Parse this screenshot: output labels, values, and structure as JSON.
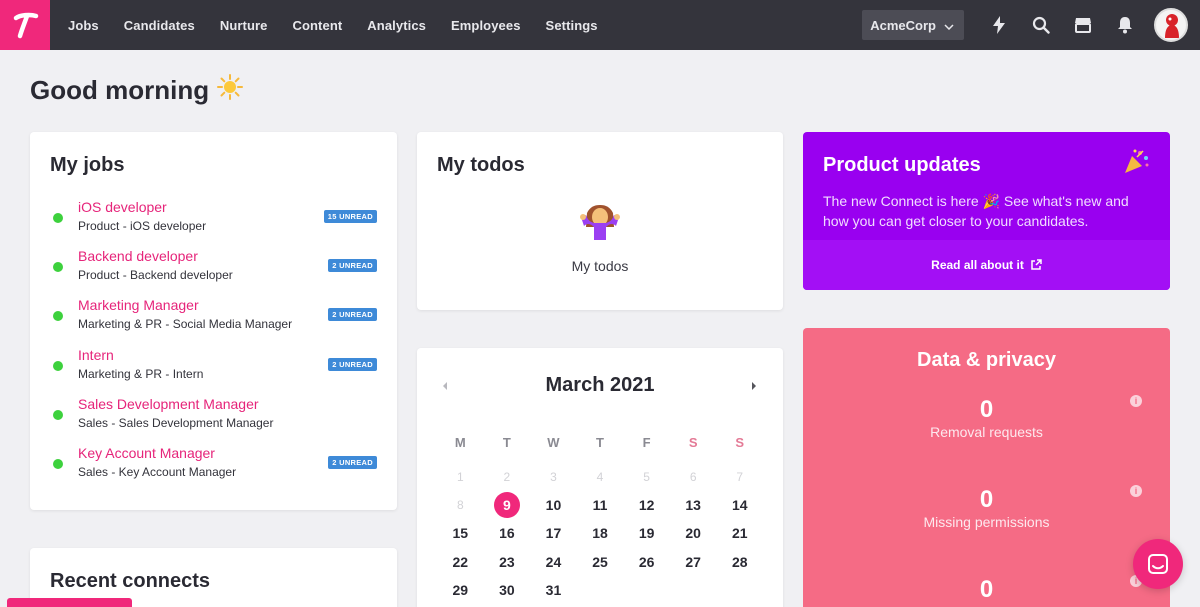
{
  "nav": {
    "logo_letter": "T",
    "items": [
      "Jobs",
      "Candidates",
      "Nurture",
      "Content",
      "Analytics",
      "Employees",
      "Settings"
    ],
    "company": "AcmeCorp"
  },
  "greeting": "Good morning",
  "jobs": {
    "title": "My jobs",
    "items": [
      {
        "title": "iOS developer",
        "sub": "Product - iOS developer",
        "badge": "15 UNREAD"
      },
      {
        "title": "Backend developer",
        "sub": "Product - Backend developer",
        "badge": "2 UNREAD"
      },
      {
        "title": "Marketing Manager",
        "sub": "Marketing & PR - Social Media Manager",
        "badge": "2 UNREAD"
      },
      {
        "title": "Intern",
        "sub": "Marketing & PR - Intern",
        "badge": "2 UNREAD"
      },
      {
        "title": "Sales Development Manager",
        "sub": "Sales - Sales Development Manager",
        "badge": ""
      },
      {
        "title": "Key Account Manager",
        "sub": "Sales - Key Account Manager",
        "badge": "2 UNREAD"
      }
    ]
  },
  "connects": {
    "title": "Recent connects"
  },
  "todos": {
    "title": "My todos",
    "empty_label": "My todos"
  },
  "calendar": {
    "month": "March 2021",
    "weekdays": [
      "M",
      "T",
      "W",
      "T",
      "F",
      "S",
      "S"
    ],
    "weeks": [
      [
        "1",
        "2",
        "3",
        "4",
        "5",
        "6",
        "7"
      ],
      [
        "8",
        "9",
        "10",
        "11",
        "12",
        "13",
        "14"
      ],
      [
        "15",
        "16",
        "17",
        "18",
        "19",
        "20",
        "21"
      ],
      [
        "22",
        "23",
        "24",
        "25",
        "26",
        "27",
        "28"
      ],
      [
        "29",
        "30",
        "31",
        "",
        "",
        "",
        ""
      ]
    ],
    "today": "9"
  },
  "updates": {
    "title": "Product updates",
    "desc": "The new Connect is here 🎉 See what's new and how you can get closer to your candidates.",
    "link": "Read all about it"
  },
  "privacy": {
    "title": "Data & privacy",
    "stats": [
      {
        "value": "0",
        "label": "Removal requests"
      },
      {
        "value": "0",
        "label": "Missing permissions"
      },
      {
        "value": "0",
        "label": ""
      }
    ]
  },
  "colors": {
    "brand": "#f0287b",
    "nav_bg": "#34343c",
    "updates_bg": "#9900f0",
    "privacy_bg": "#f56b85",
    "badge": "#3e8ad8"
  }
}
